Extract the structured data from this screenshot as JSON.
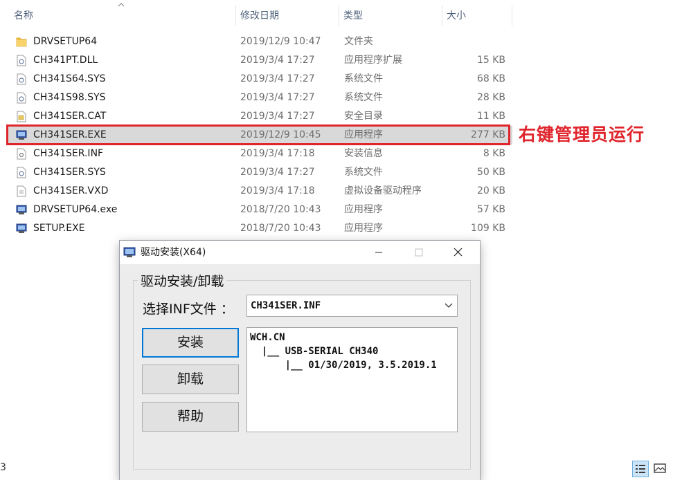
{
  "columns": {
    "name": "名称",
    "date": "修改日期",
    "type": "类型",
    "size": "大小"
  },
  "files": [
    {
      "name": "DRVSETUP64",
      "date": "2019/12/9 10:47",
      "type": "文件夹",
      "size": "",
      "icon": "folder-icon"
    },
    {
      "name": "CH341PT.DLL",
      "date": "2019/3/4 17:27",
      "type": "应用程序扩展",
      "size": "15 KB",
      "icon": "dll-file-icon"
    },
    {
      "name": "CH341S64.SYS",
      "date": "2019/3/4 17:27",
      "type": "系统文件",
      "size": "68 KB",
      "icon": "sys-file-icon"
    },
    {
      "name": "CH341S98.SYS",
      "date": "2019/3/4 17:27",
      "type": "系统文件",
      "size": "28 KB",
      "icon": "sys-file-icon"
    },
    {
      "name": "CH341SER.CAT",
      "date": "2019/3/4 17:27",
      "type": "安全目录",
      "size": "11 KB",
      "icon": "catalog-file-icon"
    },
    {
      "name": "CH341SER.EXE",
      "date": "2019/12/9 10:45",
      "type": "应用程序",
      "size": "277 KB",
      "icon": "exe-app-icon",
      "selected": true
    },
    {
      "name": "CH341SER.INF",
      "date": "2019/3/4 17:18",
      "type": "安装信息",
      "size": "8 KB",
      "icon": "inf-file-icon"
    },
    {
      "name": "CH341SER.SYS",
      "date": "2019/3/4 17:27",
      "type": "系统文件",
      "size": "50 KB",
      "icon": "sys-file-icon"
    },
    {
      "name": "CH341SER.VXD",
      "date": "2019/3/4 17:18",
      "type": "虚拟设备驱动程序",
      "size": "20 KB",
      "icon": "vxd-file-icon"
    },
    {
      "name": "DRVSETUP64.exe",
      "date": "2018/7/20 10:43",
      "type": "应用程序",
      "size": "57 KB",
      "icon": "exe-app-icon"
    },
    {
      "name": "SETUP.EXE",
      "date": "2018/7/20 10:43",
      "type": "应用程序",
      "size": "109 KB",
      "icon": "exe-app-icon"
    }
  ],
  "annotation": {
    "text": "右键管理员运行",
    "color": "#e0242c"
  },
  "status_left": "3",
  "dialog": {
    "title": "驱动安装(X64)",
    "group_label": "驱动安装/卸载",
    "inf_label": "选择INF文件 ：",
    "inf_selected": "CH341SER.INF",
    "buttons": {
      "install": "安装",
      "uninstall": "卸载",
      "help": "帮助"
    },
    "info_lines": [
      "WCH.CN",
      "  |__ USB-SERIAL CH340",
      "      |__ 01/30/2019, 3.5.2019.1"
    ]
  }
}
